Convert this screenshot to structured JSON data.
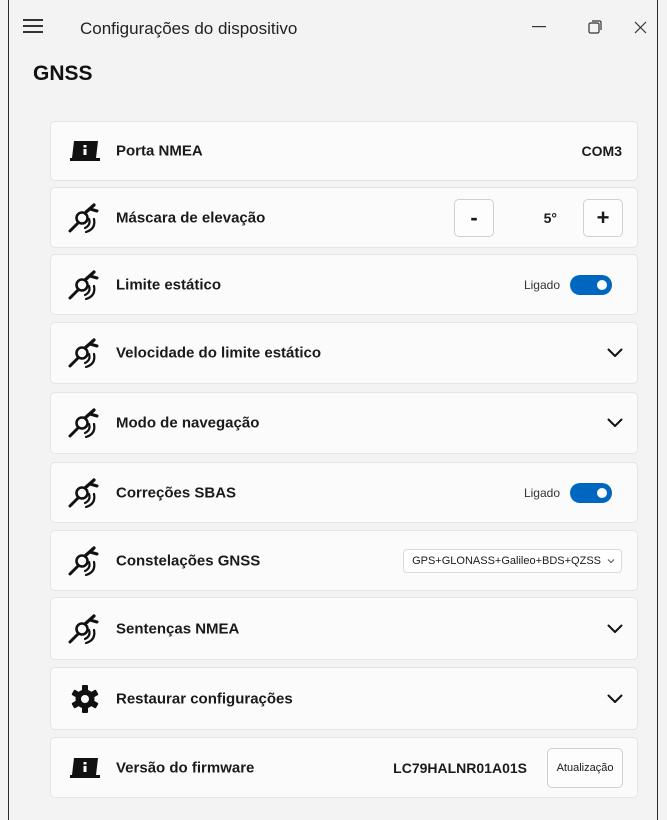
{
  "window": {
    "title": "Configurações do dispositivo"
  },
  "page": {
    "title": "GNSS"
  },
  "settings": {
    "nmea_port": {
      "label": "Porta NMEA",
      "value": "COM3",
      "icon": "device-info-icon"
    },
    "elevation_mask": {
      "label": "Máscara de elevação",
      "value": "5°",
      "minus": "-",
      "plus": "+",
      "icon": "satellite-icon"
    },
    "static_limit": {
      "label": "Limite estático",
      "state_label": "Ligado",
      "on": true,
      "icon": "satellite-icon"
    },
    "static_limit_speed": {
      "label": "Velocidade do limite estático",
      "icon": "satellite-icon"
    },
    "navigation_mode": {
      "label": "Modo de navegação",
      "icon": "satellite-icon"
    },
    "sbas_corrections": {
      "label": "Correções SBAS",
      "state_label": "Ligado",
      "on": true,
      "icon": "satellite-icon"
    },
    "gnss_constellations": {
      "label": "Constelações GNSS",
      "selected": "GPS+GLONASS+Galileo+BDS+QZSS",
      "icon": "satellite-icon"
    },
    "nmea_sentences": {
      "label": "Sentenças NMEA",
      "icon": "satellite-icon"
    },
    "restore_settings": {
      "label": "Restaurar configurações",
      "icon": "gear-icon"
    },
    "firmware_version": {
      "label": "Versão do firmware",
      "value": "LC79HALNR01A01S",
      "button": "Atualização",
      "icon": "device-info-icon"
    }
  },
  "colors": {
    "accent": "#0067c0",
    "card_bg": "#fbfbfb",
    "window_bg": "#f3f3f3"
  }
}
